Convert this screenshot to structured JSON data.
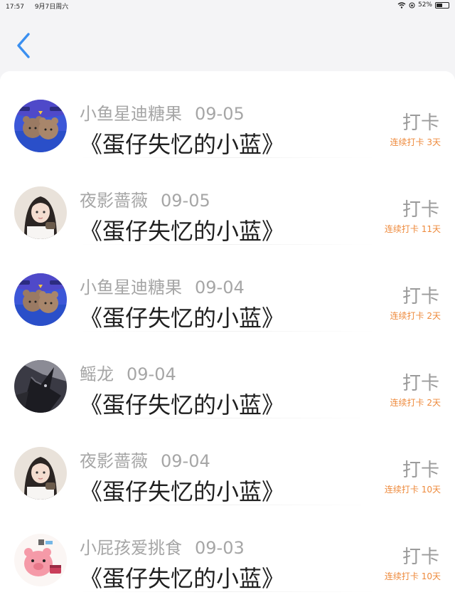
{
  "status_bar": {
    "time": "17:57",
    "date": "9月7日周六",
    "battery": "52%"
  },
  "nav": {
    "back_icon": "chevron-left-icon",
    "accent_color": "#3a8ff0"
  },
  "checkins": [
    {
      "user": "小鱼星迪糖果",
      "date": "09-05",
      "title": "《蛋仔失忆的小蓝》",
      "action": "打卡",
      "streak": "连续打卡 3天",
      "avatar": "cartoon-bears-avatar"
    },
    {
      "user": "夜影蔷薇",
      "date": "09-05",
      "title": "《蛋仔失忆的小蓝》",
      "action": "打卡",
      "streak": "连续打卡 11天",
      "avatar": "girl-photo-avatar"
    },
    {
      "user": "小鱼星迪糖果",
      "date": "09-04",
      "title": "《蛋仔失忆的小蓝》",
      "action": "打卡",
      "streak": "连续打卡 2天",
      "avatar": "cartoon-bears-avatar"
    },
    {
      "user": "鳐龙",
      "date": "09-04",
      "title": "《蛋仔失忆的小蓝》",
      "action": "打卡",
      "streak": "连续打卡 2天",
      "avatar": "dark-dragon-avatar"
    },
    {
      "user": "夜影蔷薇",
      "date": "09-04",
      "title": "《蛋仔失忆的小蓝》",
      "action": "打卡",
      "streak": "连续打卡 10天",
      "avatar": "girl-photo-avatar"
    },
    {
      "user": "小屁孩爱挑食",
      "date": "09-03",
      "title": "《蛋仔失忆的小蓝》",
      "action": "打卡",
      "streak": "连续打卡 10天",
      "avatar": "pink-pig-avatar"
    }
  ]
}
